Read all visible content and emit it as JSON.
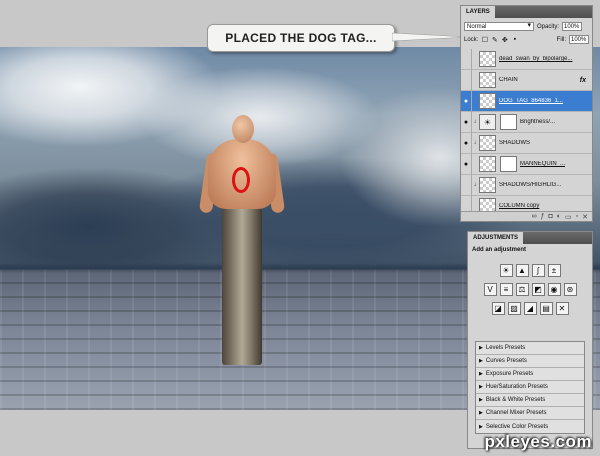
{
  "callout": {
    "text": "PLACED THE DOG TAG..."
  },
  "layers_panel": {
    "tab": "LAYERS",
    "blend_mode": "Normal",
    "opacity_label": "Opacity:",
    "opacity_value": "100%",
    "lock_label": "Lock:",
    "fill_label": "Fill:",
    "fill_value": "100%",
    "layers": [
      {
        "name": "dead_swan_by_bipolarge...",
        "visible": false,
        "selected": false
      },
      {
        "name": "CHAIN",
        "visible": false,
        "selected": false,
        "fx": "fx"
      },
      {
        "name": "DOG_TAG_864836_1...",
        "visible": true,
        "selected": true
      },
      {
        "name": "Brightness/...",
        "visible": true,
        "selected": false
      },
      {
        "name": "SHADOWS",
        "visible": true,
        "selected": false
      },
      {
        "name": "MANNEQUIN_...",
        "visible": true,
        "selected": false
      },
      {
        "name": "SHADOWS/HIGHLIG...",
        "visible": false,
        "selected": false
      },
      {
        "name": "COLUMN copy",
        "visible": false,
        "selected": false
      }
    ]
  },
  "adjustments_panel": {
    "tab": "ADJUSTMENTS",
    "title": "Add an adjustment",
    "presets": [
      "Levels Presets",
      "Curves Presets",
      "Exposure Presets",
      "Hue/Saturation Presets",
      "Black & White Presets",
      "Channel Mixer Presets",
      "Selective Color Presets"
    ]
  },
  "watermark": "pxleyes.com",
  "icons": {
    "eye": "eye-icon",
    "lock": "lock-icon",
    "triangle": "disclosure-triangle-icon"
  }
}
